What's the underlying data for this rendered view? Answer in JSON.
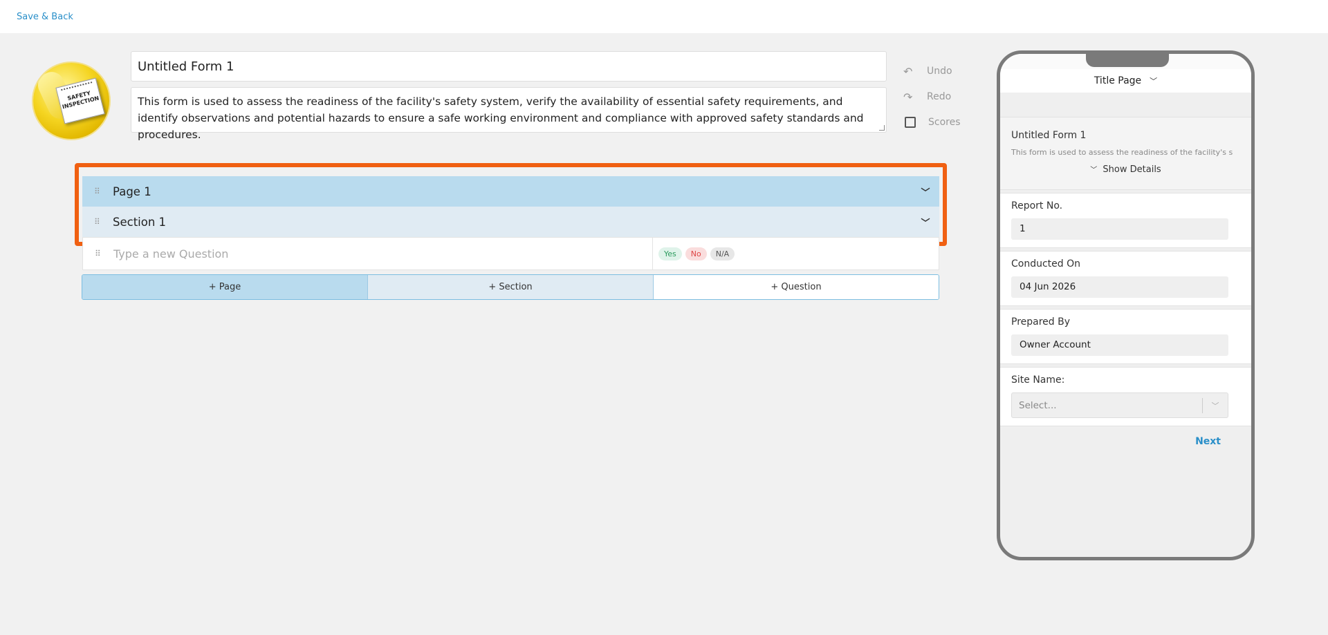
{
  "topbar": {
    "save_back": "Save & Back"
  },
  "form": {
    "title": "Untitled Form 1",
    "description": "This form is used to assess the readiness of the facility's safety system, verify the availability of essential safety requirements, and identify observations and potential hazards to ensure a safe working environment and compliance with approved safety standards and procedures.",
    "logo_text": "SAFETY INSPECTION"
  },
  "tools": {
    "undo": "Undo",
    "redo": "Redo",
    "scores": "Scores"
  },
  "builder": {
    "page_label": "Page 1",
    "section_label": "Section 1",
    "question_placeholder": "Type a new Question",
    "answers": [
      "Yes",
      "No",
      "N/A"
    ],
    "add_page": "+ Page",
    "add_section": "+ Section",
    "add_question": "+ Question"
  },
  "preview": {
    "page_selector": "Title Page",
    "intro_title": "Untitled Form 1",
    "intro_desc": "This form is used to assess the readiness of the facility's s",
    "show_details": "Show Details",
    "fields": [
      {
        "label": "Report No.",
        "value": "1"
      },
      {
        "label": "Conducted On",
        "value": "04 Jun 2026"
      },
      {
        "label": "Prepared By",
        "value": "Owner Account"
      }
    ],
    "site_label": "Site Name:",
    "site_placeholder": "Select...",
    "next": "Next"
  },
  "colors": {
    "accent": "#2a8fc9",
    "highlight": "#f06012",
    "page_row": "#b9dbee",
    "section_row": "#e0ebf3"
  }
}
